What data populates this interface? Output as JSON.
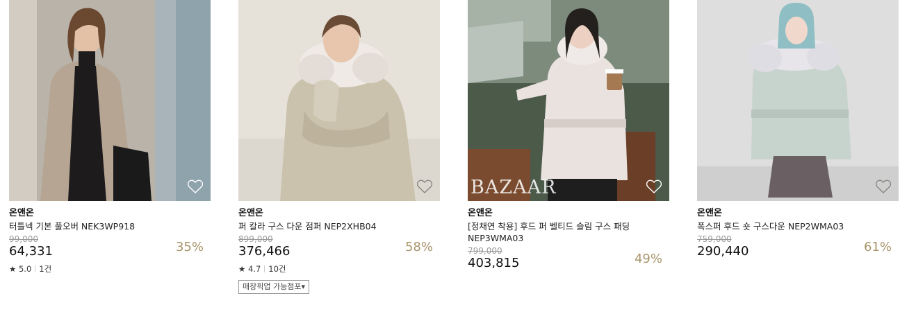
{
  "products": [
    {
      "brand": "온앤온",
      "name": "터틀넥 기본 풀오버 NEK3WP918",
      "original_price": "99,000",
      "price": "64,331",
      "discount": "35%",
      "rating": "5.0",
      "reviews": "1건"
    },
    {
      "brand": "온앤온",
      "name": "퍼 칼라 구스 다운 점퍼 NEP2XHB04",
      "original_price": "899,000",
      "price": "376,466",
      "discount": "58%",
      "rating": "4.7",
      "reviews": "10건",
      "store_pickup": "매장픽업 가능점포"
    },
    {
      "brand": "온앤온",
      "name": "[정채연 착용] 후드 퍼 벨티드 슬림 구스 패딩 NEP3WMA03",
      "original_price": "799,000",
      "price": "403,815",
      "discount": "49%",
      "watermark": "BAZAAR"
    },
    {
      "brand": "온앤온",
      "name": "폭스퍼 후드 숏 구스다운 NEP2WMA03",
      "original_price": "759,000",
      "price": "290,440",
      "discount": "61%"
    }
  ],
  "icons": {
    "wishlist": "heart-outline-icon",
    "rating": "star-icon",
    "dropdown": "triangle-down-icon"
  },
  "colors": {
    "discount": "#a8946a",
    "original_price": "#999999"
  }
}
